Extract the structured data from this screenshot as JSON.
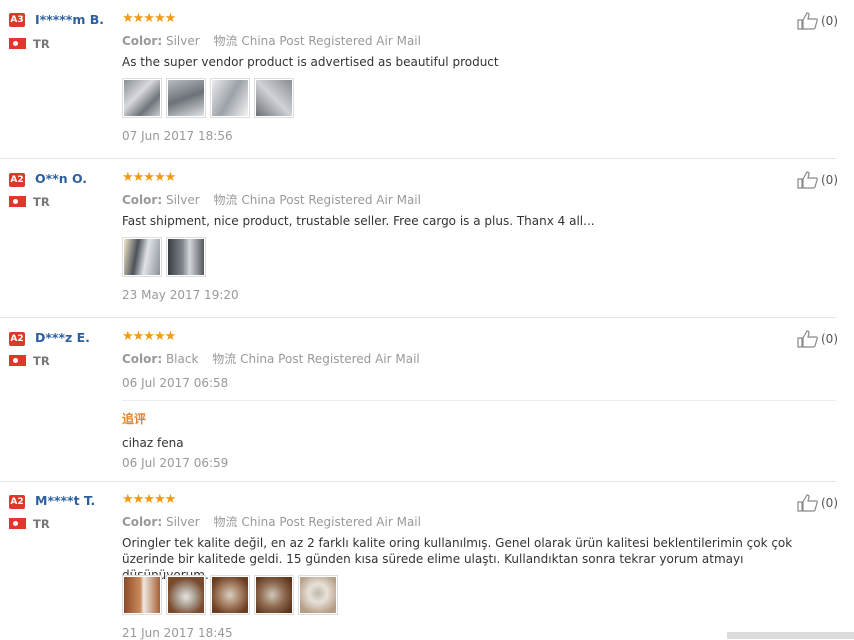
{
  "labels": {
    "color": "Color:",
    "shipping_prefix": "物流"
  },
  "stars_glyph": "★★★★★",
  "reviews": [
    {
      "level": "A3",
      "name": "I*****m B.",
      "country": "TR",
      "color": "Silver",
      "shipping": "China Post Registered Air Mail",
      "text": "As the super vendor product is advertised as beautiful product",
      "date": "07 Jun 2017 18:56",
      "likes": "(0)"
    },
    {
      "level": "A2",
      "name": "O**n O.",
      "country": "TR",
      "color": "Silver",
      "shipping": "China Post Registered Air Mail",
      "text": "Fast shipment, nice product, trustable seller. Free cargo is a plus. Thanx 4 all...",
      "date": "23 May 2017 19:20",
      "likes": "(0)"
    },
    {
      "level": "A2",
      "name": "D***z E.",
      "country": "TR",
      "color": "Black",
      "shipping": "China Post Registered Air Mail",
      "date": "06 Jul 2017 06:58",
      "likes": "(0)",
      "additional_label": "追评",
      "additional_text": "cihaz fena",
      "additional_date": "06 Jul 2017 06:59"
    },
    {
      "level": "A2",
      "name": "M****t T.",
      "country": "TR",
      "color": "Silver",
      "shipping": "China Post Registered Air Mail",
      "text": "Oringler tek kalite değil, en az 2 farklı kalite oring kullanılmış. Genel olarak ürün kalitesi beklentilerimin çok çok üzerinde bir kalitede geldi. 15 günden kısa sürede elime ulaştı. Kullandıktan sonra tekrar yorum atmayı düşünüyorum.",
      "date": "21 Jun 2017 18:45",
      "likes": "(0)"
    }
  ]
}
